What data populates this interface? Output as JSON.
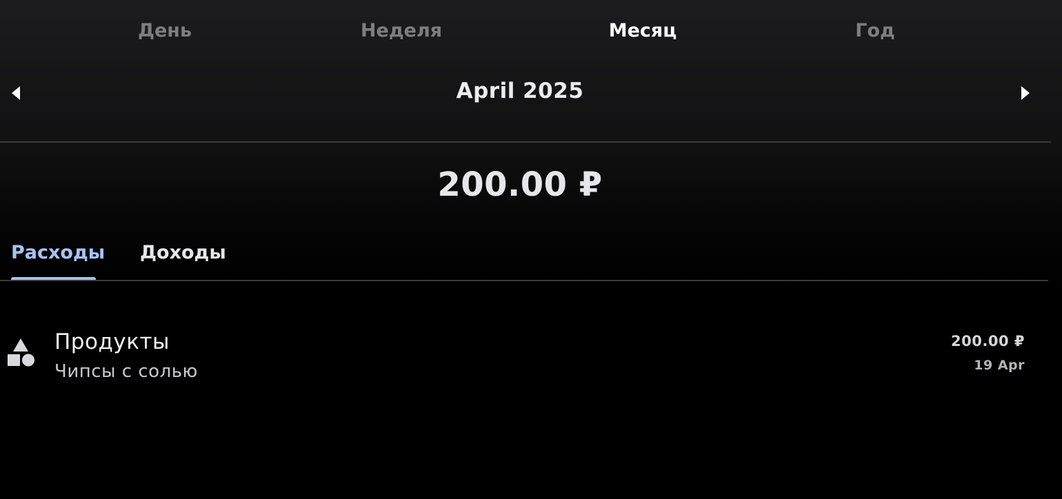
{
  "period_tabs": [
    {
      "label": "День",
      "active": false
    },
    {
      "label": "Неделя",
      "active": false
    },
    {
      "label": "Месяц",
      "active": true
    },
    {
      "label": "Год",
      "active": false
    }
  ],
  "date_nav": {
    "title": "April 2025",
    "prev_icon": "chevron-left-icon",
    "next_icon": "chevron-right-icon"
  },
  "summary": {
    "total": "200.00 ₽"
  },
  "type_tabs": [
    {
      "label": "Расходы",
      "active": true
    },
    {
      "label": "Доходы",
      "active": false
    }
  ],
  "transactions": [
    {
      "category": "Продукты",
      "note": "Чипсы с солью",
      "amount": "200.00 ₽",
      "date": "19 Apr",
      "icon": "shapes-icon"
    }
  ],
  "colors": {
    "accent": "#a9c3f2",
    "background": "#000000",
    "inactive_text": "#7d7d82"
  }
}
